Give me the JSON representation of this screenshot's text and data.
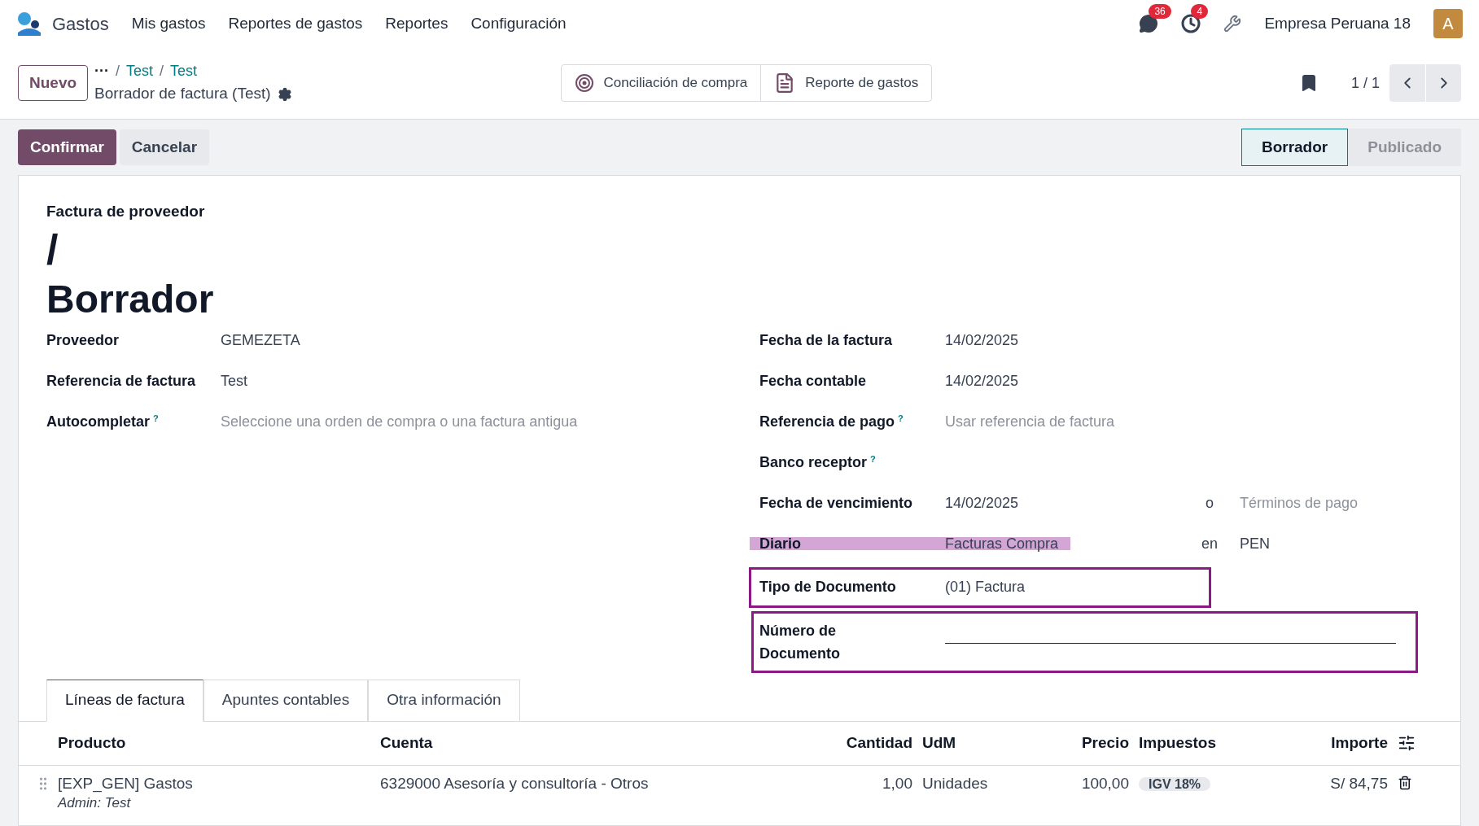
{
  "navbar": {
    "app": "Gastos",
    "menu": [
      "Mis gastos",
      "Reportes de gastos",
      "Reportes",
      "Configuración"
    ],
    "messages_badge": "36",
    "activities_badge": "4",
    "company": "Empresa Peruana 18",
    "avatar": "A"
  },
  "control_panel": {
    "new_button": "Nuevo",
    "breadcrumb_more": "···",
    "breadcrumb_separator": "/",
    "breadcrumbs": [
      "Test",
      "Test"
    ],
    "record_title": "Borrador de factura (Test)",
    "smart_buttons": [
      {
        "kind": "target",
        "label": "Conciliación de compra"
      },
      {
        "kind": "document",
        "label": "Reporte de gastos"
      }
    ],
    "pager": "1 / 1"
  },
  "actions": {
    "buttons": [
      {
        "label": "Confirmar",
        "primary": true
      },
      {
        "label": "Cancelar",
        "primary": false
      }
    ],
    "status": [
      {
        "label": "Borrador",
        "selected": true
      },
      {
        "label": "Publicado",
        "selected": false
      }
    ]
  },
  "form": {
    "subtitle": "Factura de proveedor",
    "name": "/",
    "state_title": "Borrador",
    "left_fields": [
      {
        "label": "Proveedor",
        "value": "GEMEZETA"
      },
      {
        "label": "Referencia de factura",
        "value": "Test"
      },
      {
        "label": "Autocompletar",
        "help": "?",
        "placeholder": "Seleccione una orden de compra o una factura antigua"
      }
    ],
    "right_fields": [
      {
        "label": "Fecha de la factura",
        "value": "14/02/2025"
      },
      {
        "label": "Fecha contable",
        "value": "14/02/2025"
      },
      {
        "label": "Referencia de pago",
        "help": "?",
        "placeholder": "Usar referencia de factura"
      },
      {
        "label": "Banco receptor",
        "help": "?"
      },
      {
        "label": "Fecha de vencimiento",
        "value": "14/02/2025",
        "joiner": "o",
        "extra_placeholder": "Términos de pago"
      },
      {
        "label": "Diario",
        "value": "Facturas Compra",
        "joiner": "en",
        "extra": "PEN",
        "highlighted": true,
        "outlined": false
      },
      {
        "label": "Tipo de Documento",
        "value": "(01) Factura",
        "highlighted": false,
        "outlined": true
      },
      {
        "label": "Número de Documento",
        "input": true,
        "highlighted": false,
        "outlined": true
      }
    ]
  },
  "tabs": [
    {
      "label": "Líneas de factura",
      "selected": true
    },
    {
      "label": "Apuntes contables",
      "selected": false
    },
    {
      "label": "Otra información",
      "selected": false
    }
  ],
  "table": {
    "columns": [
      "Producto",
      "Cuenta",
      "Cantidad",
      "UdM",
      "Precio",
      "Impuestos",
      "Importe"
    ],
    "rows": [
      {
        "product": "[EXP_GEN] Gastos",
        "note": "Admin: Test",
        "account": "6329000 Asesoría y consultoría - Otros",
        "quantity": "1,00",
        "uom": "Unidades",
        "price": "100,00",
        "tax": "IGV 18%",
        "amount": "S/ 84,75"
      }
    ]
  }
}
